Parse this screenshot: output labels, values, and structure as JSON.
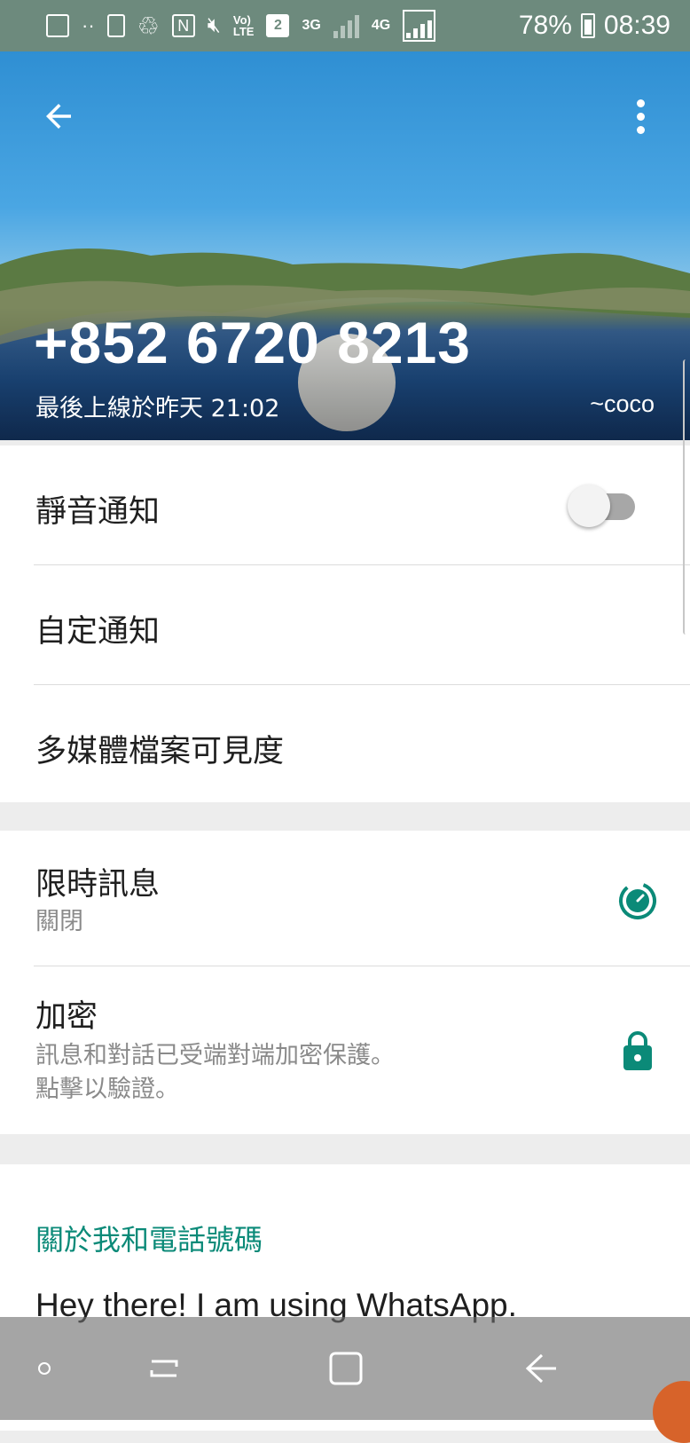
{
  "status_bar": {
    "network_3g": "3G",
    "network_4g": "4G",
    "volte": "Vo)\nLTE",
    "sim": "2",
    "battery": "78%",
    "time": "08:39",
    "icons": [
      "image-icon",
      "more-dots-icon",
      "battery-saver-icon",
      "recycle-icon",
      "nfc-icon",
      "mute-icon",
      "volte-icon",
      "sim-icon",
      "signal-icon",
      "battery-icon"
    ]
  },
  "header": {
    "back_icon": "arrow-left-icon",
    "menu_icon": "more-vert-icon",
    "phone": "+852 6720 8213",
    "last_seen": "最後上線於昨天 21:02",
    "push_name": "~coco"
  },
  "settings": {
    "mute": {
      "label": "靜音通知",
      "enabled": false
    },
    "custom_notifications": {
      "label": "自定通知"
    },
    "media_visibility": {
      "label": "多媒體檔案可見度"
    },
    "disappearing": {
      "label": "限時訊息",
      "value": "關閉",
      "icon": "timer-icon"
    },
    "encryption": {
      "label": "加密",
      "line1": "訊息和對話已受端對端加密保護。",
      "line2": "點擊以驗證。",
      "icon": "lock-icon"
    }
  },
  "about": {
    "section_title": "關於我和電話號碼",
    "text": "Hey there! I am using WhatsApp."
  },
  "nav_bar": {
    "items": [
      "recent-apps-dot-icon",
      "recents-icon",
      "home-icon",
      "back-icon"
    ]
  },
  "colors": {
    "accent": "#0b8a78",
    "status_bar": "#6d8a7d"
  }
}
